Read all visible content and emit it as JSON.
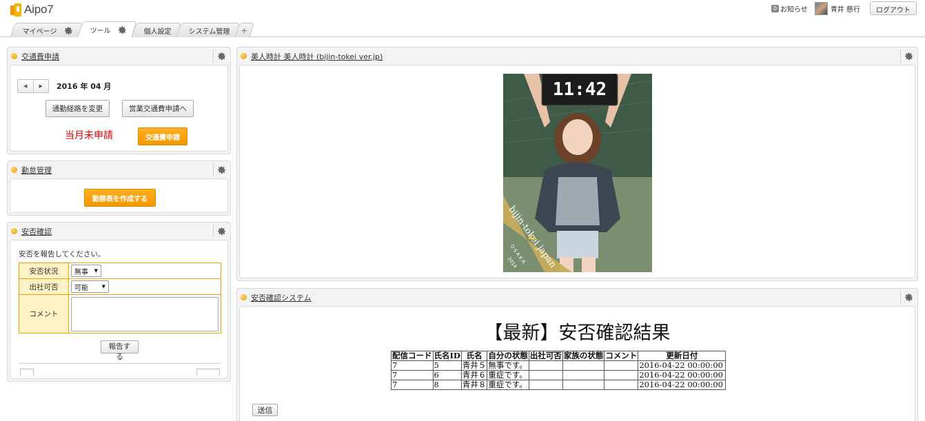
{
  "header": {
    "logo_text": "Aipo7",
    "notice_count": "0",
    "notice_label": "お知らせ",
    "user_name": "青井 慈行",
    "logout_label": "ログアウト"
  },
  "tabs": [
    {
      "label": "マイページ"
    },
    {
      "label": "ツール"
    },
    {
      "label": "個人設定"
    },
    {
      "label": "システム管理"
    },
    {
      "label": "+"
    }
  ],
  "transport": {
    "title": "交通費申請",
    "month_label": "2016 年 04 月",
    "prev_icon": "◀",
    "next_icon": "▶",
    "change_route_label": "通勤経路を変更",
    "sales_expense_label": "営業交通費申請へ",
    "status_text": "当月未申請",
    "apply_label": "交通費申請"
  },
  "attendance": {
    "title": "勤怠管理",
    "create_label": "勤務表を作成する"
  },
  "safety": {
    "title": "安否確認",
    "prompt": "安否を報告してください。",
    "status_label": "安否状況",
    "status_value": "無事",
    "attend_label": "出社可否",
    "attend_value": "可能",
    "comment_label": "コメント",
    "report_label": "報告する"
  },
  "clock": {
    "title": "美人時計 美人時計 (bijin-tokei ver.jp)",
    "time": "11:42",
    "banner_text": "bijin-tokei japan",
    "city": "OSAKA",
    "year": "2014"
  },
  "results": {
    "portlet_title": "安否確認システム",
    "heading": "【最新】安否確認結果",
    "columns": [
      "配信コード",
      "氏名ID",
      "氏名",
      "自分の状態",
      "出社可否",
      "家族の状態",
      "コメント",
      "更新日付"
    ],
    "rows": [
      [
        "7",
        "5",
        "青井５",
        "無事です。",
        "",
        "",
        "",
        "2016-04-22 00:00:00"
      ],
      [
        "7",
        "6",
        "青井６",
        "重症です。",
        "",
        "",
        "",
        "2016-04-22 00:00:00"
      ],
      [
        "7",
        "8",
        "青井８",
        "重症です。",
        "",
        "",
        "",
        "2016-04-22 00:00:00"
      ]
    ],
    "send_label": "送信"
  },
  "colors": {
    "accent_orange": "#f39800",
    "status_red": "#e00000",
    "label_bg": "#fff2c4"
  }
}
